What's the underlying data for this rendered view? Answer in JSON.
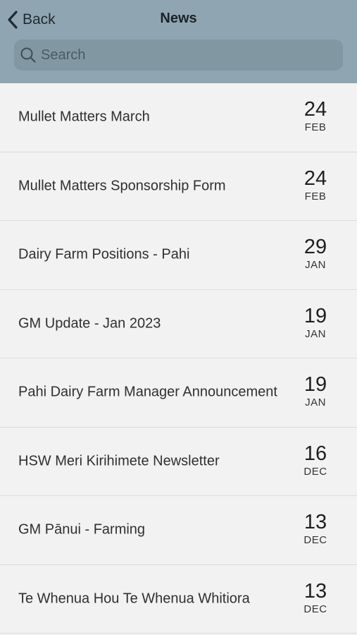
{
  "header": {
    "back_label": "Back",
    "title": "News",
    "search_placeholder": "Search",
    "background": "#8fa6b2"
  },
  "news": [
    {
      "title": "Mullet Matters March",
      "day": "24",
      "month": "FEB"
    },
    {
      "title": "Mullet Matters Sponsorship Form",
      "day": "24",
      "month": "FEB"
    },
    {
      "title": "Dairy Farm Positions - Pahi",
      "day": "29",
      "month": "JAN"
    },
    {
      "title": "GM Update - Jan 2023",
      "day": "19",
      "month": "JAN"
    },
    {
      "title": "Pahi Dairy Farm Manager Announcement",
      "day": "19",
      "month": "JAN"
    },
    {
      "title": "HSW Meri Kirihimete Newsletter",
      "day": "16",
      "month": "DEC"
    },
    {
      "title": "GM Pānui - Farming",
      "day": "13",
      "month": "DEC"
    },
    {
      "title": "Te Whenua Hou Te Whenua Whitiora",
      "day": "13",
      "month": "DEC"
    }
  ]
}
